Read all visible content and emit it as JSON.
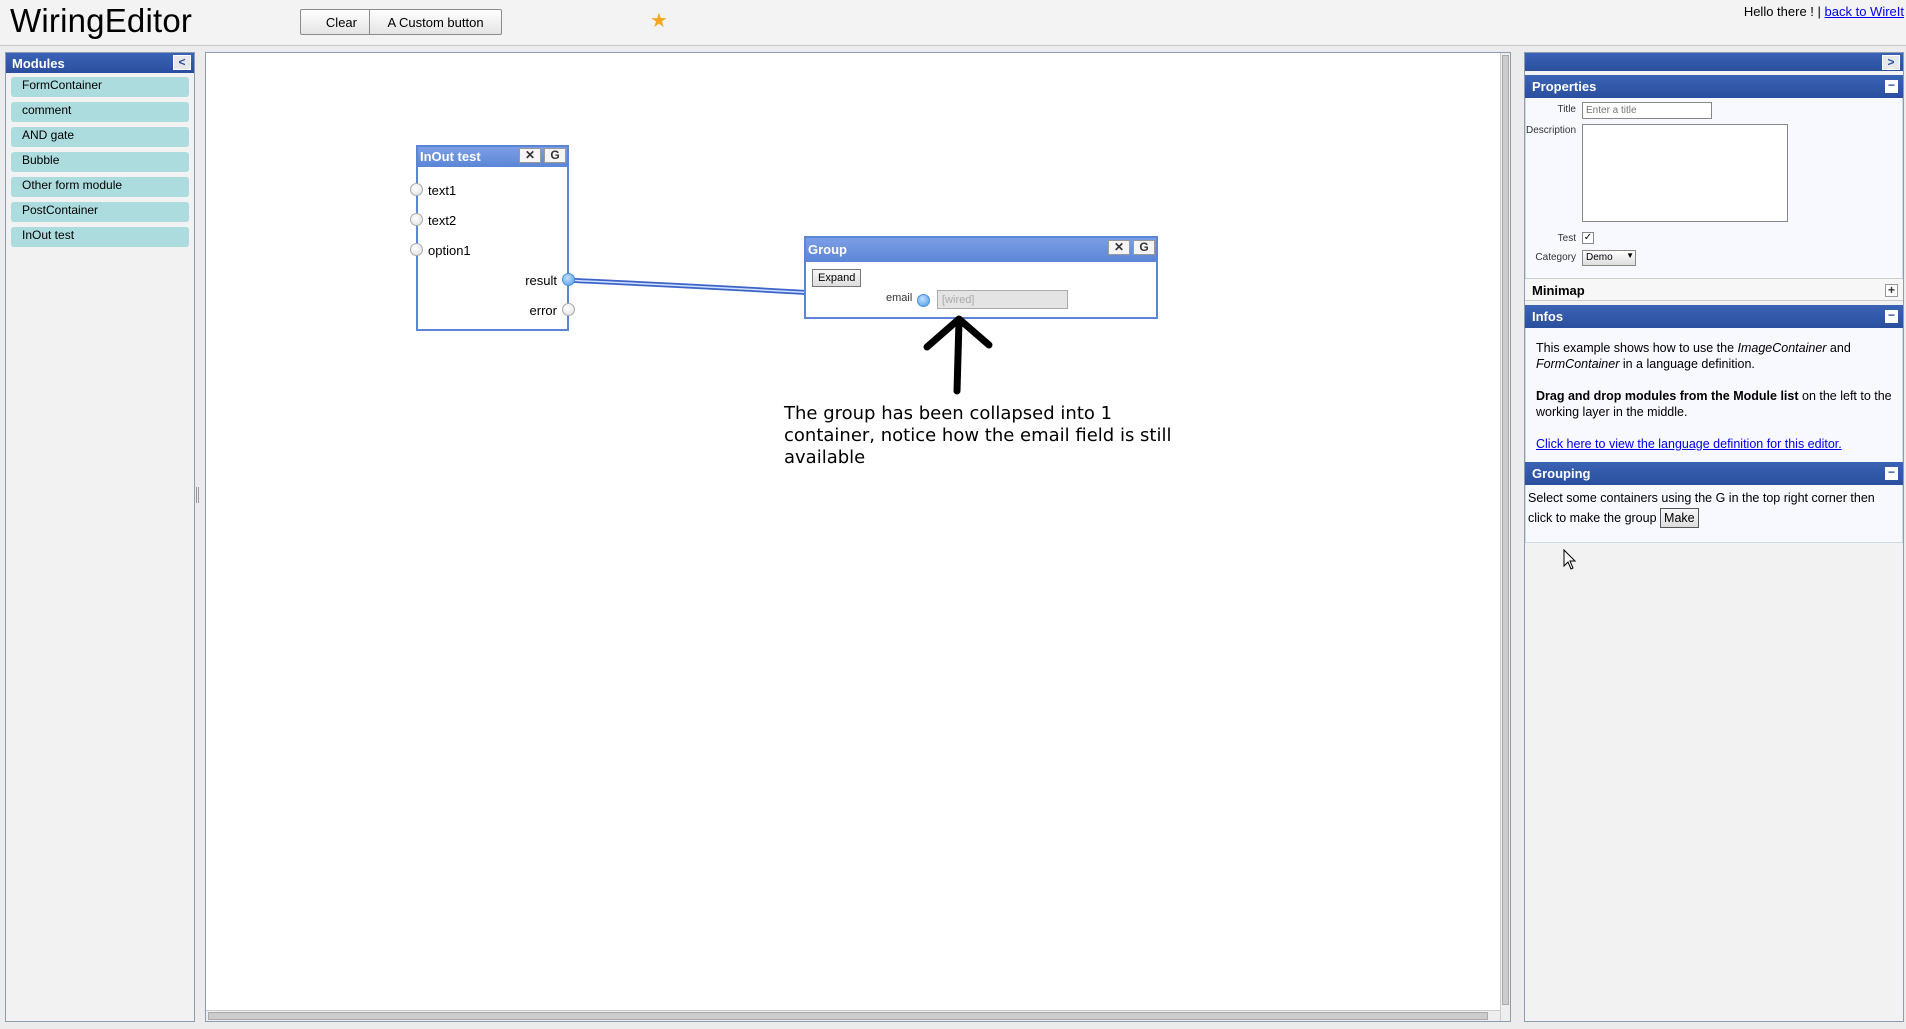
{
  "header": {
    "title": "WiringEditor",
    "toolbar": {
      "clear_label": "Clear",
      "custom_label": "A Custom button"
    },
    "star": "★",
    "greeting": "Hello there ! |",
    "back_link": "back to WireIt"
  },
  "modules": {
    "title": "Modules",
    "collapse_glyph": "<",
    "items": [
      "FormContainer",
      "comment",
      "AND gate",
      "Bubble",
      "Other form module",
      "PostContainer",
      "InOut test"
    ]
  },
  "canvas": {
    "inout_container": {
      "title": "InOut test",
      "close_glyph": "✕",
      "group_glyph": "G",
      "inputs": [
        "text1",
        "text2",
        "option1"
      ],
      "outputs": [
        "result",
        "error"
      ]
    },
    "group_container": {
      "title": "Group",
      "close_glyph": "✕",
      "group_glyph": "G",
      "expand_label": "Expand",
      "field_label": "email",
      "field_value": "[wired]"
    },
    "annotation": "The group has been collapsed into 1 container, notice how the email field is still available"
  },
  "right_panel": {
    "collapse_glyph": ">",
    "properties": {
      "title": "Properties",
      "toggle": "−",
      "title_label": "Title",
      "title_placeholder": "Enter a title",
      "description_label": "Description",
      "test_label": "Test",
      "test_checked": true,
      "category_label": "Category",
      "category_value": "Demo"
    },
    "minimap": {
      "title": "Minimap",
      "toggle": "+"
    },
    "infos": {
      "title": "Infos",
      "toggle": "−",
      "p1_a": "This example shows how to use the ",
      "p1_b": "ImageContainer",
      "p1_c": " and ",
      "p1_d": "FormContainer",
      "p1_e": " in a language definition.",
      "p2_bold": "Drag and drop modules from the Module list",
      "p2_rest": " on the left to the working layer in the middle.",
      "link": "Click here to view the language definition for this editor."
    },
    "grouping": {
      "title": "Grouping",
      "toggle": "−",
      "text": "Select some containers using the G in the top right corner then click to make the group",
      "make_label": "Make"
    }
  },
  "colors": {
    "accent": "#2a4f9e",
    "container_border": "#5b86d6",
    "module_item": "#acdcde",
    "star": "#f5a623"
  }
}
